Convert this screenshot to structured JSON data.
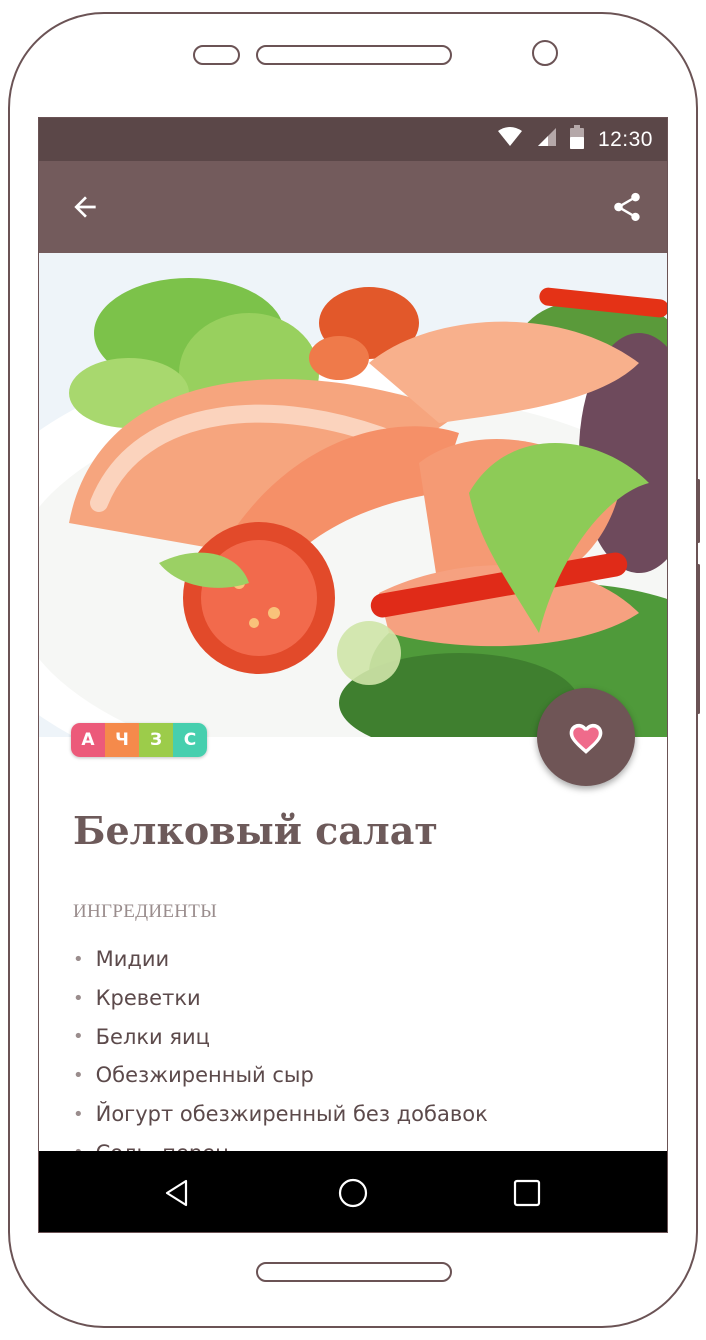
{
  "status_bar": {
    "time": "12:30"
  },
  "app_bar": {
    "back_icon": "arrow-back-icon",
    "share_icon": "share-icon"
  },
  "recipe": {
    "title": "Белковый салат",
    "diet_tags": [
      {
        "letter": "А",
        "color": "#ec5a7a"
      },
      {
        "letter": "Ч",
        "color": "#f58a4b"
      },
      {
        "letter": "З",
        "color": "#9ccc4a"
      },
      {
        "letter": "С",
        "color": "#46cfae"
      }
    ],
    "favorite_icon": "heart-icon",
    "ingredients_label": "ИНГРЕДИЕНТЫ",
    "ingredients": [
      "Мидии",
      "Креветки",
      "Белки яиц",
      "Обезжиренный сыр",
      "Йогурт обезжиренный без добавок",
      "Соль, перец"
    ]
  },
  "colors": {
    "status_bar": "#5b4748",
    "app_bar": "#735b5c",
    "accent": "#6f5556",
    "heart": "#ef6b8b",
    "title_text": "#6d5a5a"
  },
  "nav_bar": {
    "icons": [
      "nav-back-icon",
      "nav-home-icon",
      "nav-recents-icon"
    ]
  }
}
